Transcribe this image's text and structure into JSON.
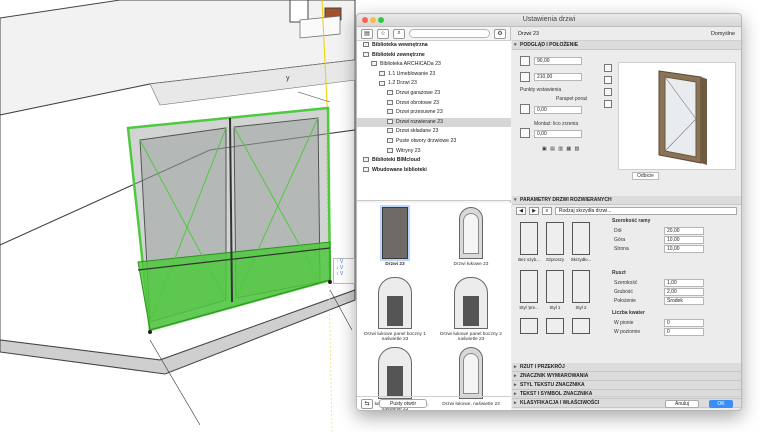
{
  "dialog": {
    "title": "Ustawienia drzwi",
    "tree": [
      {
        "label": "Biblioteka wewnętrzna",
        "indent": 0,
        "bold": true
      },
      {
        "label": "Biblioteki zewnętrzne",
        "indent": 0,
        "bold": true
      },
      {
        "label": "Biblioteka ARCHICADa 23",
        "indent": 1
      },
      {
        "label": "1.1 Umeblowanie 23",
        "indent": 2
      },
      {
        "label": "1.2 Drzwi 23",
        "indent": 2
      },
      {
        "label": "Drzwi garażowe 23",
        "indent": 3
      },
      {
        "label": "Drzwi obrotowe 23",
        "indent": 3
      },
      {
        "label": "Drzwi przesuwne 23",
        "indent": 3
      },
      {
        "label": "Drzwi rozwierane 23",
        "indent": 3,
        "selected": true
      },
      {
        "label": "Drzwi składane 23",
        "indent": 3
      },
      {
        "label": "Puste otwory drzwiowe 23",
        "indent": 3
      },
      {
        "label": "Witryny 23",
        "indent": 3
      },
      {
        "label": "Biblioteki BIMcloud",
        "indent": 0,
        "bold": true
      },
      {
        "label": "Wbudowane biblioteki",
        "indent": 0,
        "bold": true
      }
    ],
    "gallery": [
      {
        "label": "Drzwi 23",
        "shape": "rect",
        "selected": true
      },
      {
        "label": "Drzwi łukowe 23",
        "shape": "arch"
      },
      {
        "label": "Drzwi łukowe panel boczny 1 naświetle 23",
        "shape": "panel"
      },
      {
        "label": "Drzwi łukowe panel boczny 2 naświetle 23",
        "shape": "panel"
      },
      {
        "label": "Drzwi łukowe, 2 panele boczne, naświetle 23",
        "shape": "panel"
      },
      {
        "label": "Drzwi łukowe, naświetle 23",
        "shape": "arch"
      }
    ],
    "empty_opening_button": "Pusty otwór",
    "object_name": "Drzwi 23",
    "default_label": "Domyślne",
    "sections": {
      "preview": "PODGLĄD I POŁOŻENIE",
      "params": "PARAMETRY DRZWI ROZWIERANYCH",
      "plan": "RZUT I PRZEKRÓJ",
      "dim_marker": "ZNACZNIK WYMIAROWANIA",
      "marker_style": "STYL TEKSTU ZNACZNIKA",
      "text_marker": "TEKST I SYMBOL ZNACZNIKA",
      "classification": "KLASYFIKACJA I WŁAŚCIWOŚCI"
    },
    "width_value": "90,00",
    "height_value": "210,00",
    "anchor_label": "Punkty wstawienia",
    "anchor_value": "Parapet poraż",
    "sill_value": "0,00",
    "mount_label": "Montaż: lico zrzenia",
    "mount_value": "0,00",
    "preview_button": "Odbicie",
    "sash_type": "Rodzaj skrzydła drzwi...",
    "frame_thumbs": [
      "Bez szyb...",
      "Szproszy",
      "Skrzydło..."
    ],
    "style_thumbs": [
      "Styl 'pre...",
      "Styl 1",
      "Styl 2"
    ],
    "frame_width_label": "Szerokość ramy",
    "frame_rows": [
      {
        "label": "Dół",
        "value": "20,00"
      },
      {
        "label": "Góra",
        "value": "10,00"
      },
      {
        "label": "Strona",
        "value": "10,00"
      }
    ],
    "mullion_label": "Ruszt",
    "mullion_rows": [
      {
        "label": "Szerokość",
        "value": "1,00"
      },
      {
        "label": "Grubość",
        "value": "2,00"
      },
      {
        "label": "Położenie",
        "value": "Środek"
      }
    ],
    "panel_count_label": "Liczba kwater",
    "panel_rows": [
      {
        "label": "W pionie",
        "value": "0"
      },
      {
        "label": "W poziomie",
        "value": "0"
      }
    ],
    "cancel": "Anuluj",
    "ok": "OK"
  },
  "gizmo": {
    "lines": [
      "↑ V",
      "↕ V",
      "↕ V"
    ]
  },
  "colors": {
    "accent": "#3a8ef6",
    "selection": "#4fc93e",
    "door_wood": "#8b7356"
  }
}
